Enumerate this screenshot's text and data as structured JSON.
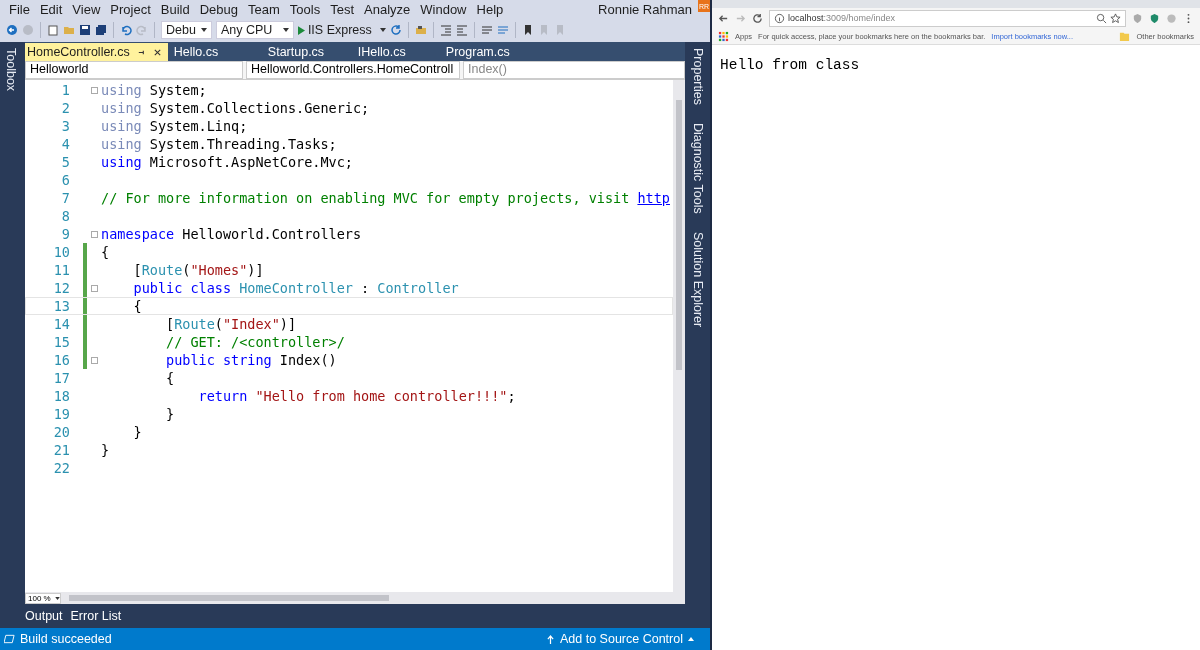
{
  "ide": {
    "menu": [
      "File",
      "Edit",
      "View",
      "Project",
      "Build",
      "Debug",
      "Team",
      "Tools",
      "Test",
      "Analyze",
      "Window",
      "Help"
    ],
    "user": {
      "name": "Ronnie Rahman",
      "initials": "RR"
    },
    "toolbar": {
      "configuration": "Debu",
      "platform": "Any CPU",
      "run_target": "IIS Express"
    },
    "left_rail": [
      "Toolbox"
    ],
    "tabs": [
      {
        "label": "HomeController.cs",
        "selected": true
      },
      {
        "label": "Hello.cs",
        "selected": false
      },
      {
        "label": "Startup.cs",
        "selected": false
      },
      {
        "label": "IHello.cs",
        "selected": false
      },
      {
        "label": "Program.cs",
        "selected": false
      }
    ],
    "nav": {
      "project": "Helloworld",
      "type": "Helloworld.Controllers.HomeControll",
      "member": "Index()"
    },
    "code": [
      {
        "n": "1",
        "fold": true,
        "changed": false,
        "tokens": [
          {
            "kind": "faded",
            "t": "using"
          },
          {
            "kind": "plain",
            "t": " System;"
          }
        ]
      },
      {
        "n": "2",
        "fold": false,
        "changed": false,
        "tokens": [
          {
            "kind": "faded",
            "t": "using"
          },
          {
            "kind": "plain",
            "t": " System.Collections.Generic;"
          }
        ]
      },
      {
        "n": "3",
        "fold": false,
        "changed": false,
        "tokens": [
          {
            "kind": "faded",
            "t": "using"
          },
          {
            "kind": "plain",
            "t": " System.Linq;"
          }
        ]
      },
      {
        "n": "4",
        "fold": false,
        "changed": false,
        "tokens": [
          {
            "kind": "faded",
            "t": "using"
          },
          {
            "kind": "plain",
            "t": " System.Threading.Tasks;"
          }
        ]
      },
      {
        "n": "5",
        "fold": false,
        "changed": false,
        "tokens": [
          {
            "kind": "keyword",
            "t": "using"
          },
          {
            "kind": "plain",
            "t": " Microsoft.AspNetCore.Mvc;"
          }
        ]
      },
      {
        "n": "6",
        "fold": false,
        "changed": false
      },
      {
        "n": "7",
        "fold": false,
        "changed": false,
        "tokens": [
          {
            "kind": "comment",
            "t": "// For more information on enabling MVC for empty projects, visit "
          },
          {
            "kind": "link",
            "t": "http"
          }
        ]
      },
      {
        "n": "8",
        "fold": false,
        "changed": false
      },
      {
        "n": "9",
        "fold": true,
        "changed": false,
        "tokens": [
          {
            "kind": "keyword",
            "t": "namespace"
          },
          {
            "kind": "plain",
            "t": " Helloworld.Controllers"
          }
        ]
      },
      {
        "n": "10",
        "fold": false,
        "changed": true,
        "tokens": [
          {
            "kind": "plain",
            "t": "{"
          }
        ]
      },
      {
        "n": "11",
        "fold": false,
        "changed": true,
        "tokens": [
          {
            "kind": "plain",
            "t": "    ["
          },
          {
            "kind": "type",
            "t": "Route"
          },
          {
            "kind": "plain",
            "t": "("
          },
          {
            "kind": "string",
            "t": "\"Homes\""
          },
          {
            "kind": "plain",
            "t": ")]"
          }
        ]
      },
      {
        "n": "12",
        "fold": true,
        "changed": true,
        "tokens": [
          {
            "kind": "keyword",
            "t": "    public class"
          },
          {
            "kind": "type",
            "t": " HomeController"
          },
          {
            "kind": "plain",
            "t": " : "
          },
          {
            "kind": "type",
            "t": "Controller"
          }
        ]
      },
      {
        "n": "13",
        "fold": false,
        "changed": true,
        "tokens": [
          {
            "kind": "plain",
            "t": "    {"
          }
        ]
      },
      {
        "n": "14",
        "fold": false,
        "changed": true,
        "tokens": [
          {
            "kind": "plain",
            "t": "        ["
          },
          {
            "kind": "type",
            "t": "Route"
          },
          {
            "kind": "plain",
            "t": "("
          },
          {
            "kind": "string",
            "t": "\"Index\""
          },
          {
            "kind": "plain",
            "t": ")]"
          }
        ]
      },
      {
        "n": "15",
        "fold": false,
        "changed": true,
        "tokens": [
          {
            "kind": "comment",
            "t": "        // GET: /<controller>/"
          }
        ]
      },
      {
        "n": "16",
        "fold": true,
        "changed": true,
        "tokens": [
          {
            "kind": "keyword",
            "t": "        public string"
          },
          {
            "kind": "plain",
            "t": " Index()"
          }
        ]
      },
      {
        "n": "17",
        "fold": false,
        "changed": false,
        "tokens": [
          {
            "kind": "plain",
            "t": "        {"
          }
        ]
      },
      {
        "n": "18",
        "fold": false,
        "changed": false,
        "tokens": [
          {
            "kind": "keyword",
            "t": "            return"
          },
          {
            "kind": "string",
            "t": " \"Hello from home controller!!!\""
          },
          {
            "kind": "plain",
            "t": ";"
          }
        ]
      },
      {
        "n": "19",
        "fold": false,
        "changed": false,
        "tokens": [
          {
            "kind": "plain",
            "t": "        }"
          }
        ]
      },
      {
        "n": "20",
        "fold": false,
        "changed": false,
        "tokens": [
          {
            "kind": "plain",
            "t": "    }"
          }
        ]
      },
      {
        "n": "21",
        "fold": false,
        "changed": false,
        "tokens": [
          {
            "kind": "plain",
            "t": "}"
          }
        ]
      },
      {
        "n": "22",
        "fold": false,
        "changed": false
      }
    ],
    "zoom": "100 %",
    "right_rail": [
      "Properties",
      "Diagnostic Tools",
      "Solution Explorer"
    ],
    "bottom_tabs": [
      "Output",
      "Error List"
    ],
    "status_bar": {
      "message": "Build succeeded",
      "action": "Add to Source Control"
    }
  },
  "browser": {
    "url_host": "localhost",
    "url_rest": ":3009/home/index",
    "bookmarks": {
      "apps": "Apps",
      "hint": "For quick access, place your bookmarks here on the bookmarks bar.",
      "import_link": "Import bookmarks now...",
      "other": "Other bookmarks"
    },
    "content": "Hello from class"
  }
}
